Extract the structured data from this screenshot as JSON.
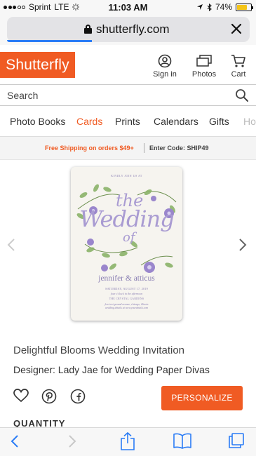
{
  "status_bar": {
    "carrier": "Sprint",
    "network": "LTE",
    "time": "11:03 AM",
    "battery": "74%",
    "battery_fraction": 0.74
  },
  "browser": {
    "url": "shutterfly.com",
    "load_progress_fraction": 0.35
  },
  "header": {
    "logo": "Shutterfly",
    "sign_in": "Sign in",
    "photos": "Photos",
    "cart": "Cart"
  },
  "search": {
    "placeholder": "Search"
  },
  "nav": {
    "items": [
      "Photo Books",
      "Cards",
      "Prints",
      "Calendars",
      "Gifts",
      "Ho"
    ],
    "active": "Cards"
  },
  "promo": {
    "shipping": "Free Shipping on orders $49+",
    "code": "Enter Code: SHIP49"
  },
  "card_preview": {
    "pre_heading": "KINDLY JOIN US AT",
    "the": "the",
    "wedding": "Wedding",
    "of": "of",
    "names": "jennifer & atticus",
    "date": "SATURDAY, AUGUST 17, 2019",
    "time": "four o'clock in the afternoon",
    "venue": "THE CRYSTAL GARDENS",
    "address1": "free text ground avenue, chicago, illinois",
    "address2": "wedding details at www.yourdetails.com"
  },
  "product": {
    "title": "Delightful Blooms Wedding Invitation",
    "designer": "Designer: Lady Jae for Wedding Paper Divas",
    "personalize": "PERSONALIZE",
    "quantity_label": "QUANTITY"
  },
  "colors": {
    "brand": "#f05b23",
    "link_blue": "#2a7cf6",
    "invite_lavender": "#a99bd2"
  },
  "icons": {
    "status": [
      "signal-dots-icon",
      "loading-spinner-icon",
      "location-arrow-icon",
      "bluetooth-icon",
      "battery-icon"
    ],
    "header": [
      "user-circle-icon",
      "photos-stack-icon",
      "cart-icon"
    ],
    "social": [
      "heart-icon",
      "pinterest-icon",
      "facebook-icon"
    ],
    "toolbar": [
      "back-chevron-icon",
      "forward-chevron-icon",
      "share-icon",
      "bookmarks-icon",
      "tabs-icon"
    ]
  }
}
